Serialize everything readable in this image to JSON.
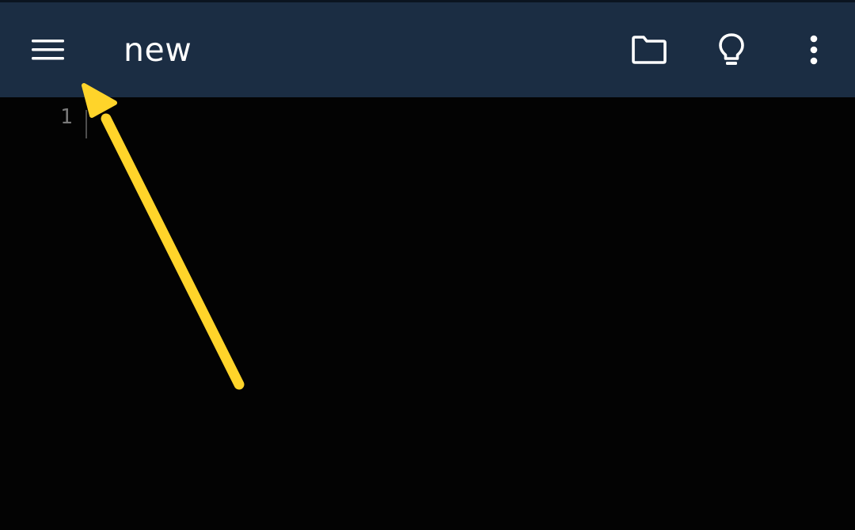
{
  "appbar": {
    "title": "new",
    "background": "#1b2d43",
    "icons": {
      "menu": "hamburger-menu-icon",
      "folder": "folder-icon",
      "bulb": "lightbulb-icon",
      "more": "more-vertical-icon"
    }
  },
  "editor": {
    "background": "#030303",
    "line_numbers": [
      "1"
    ]
  },
  "annotation": {
    "arrow_color": "#ffd42a"
  }
}
